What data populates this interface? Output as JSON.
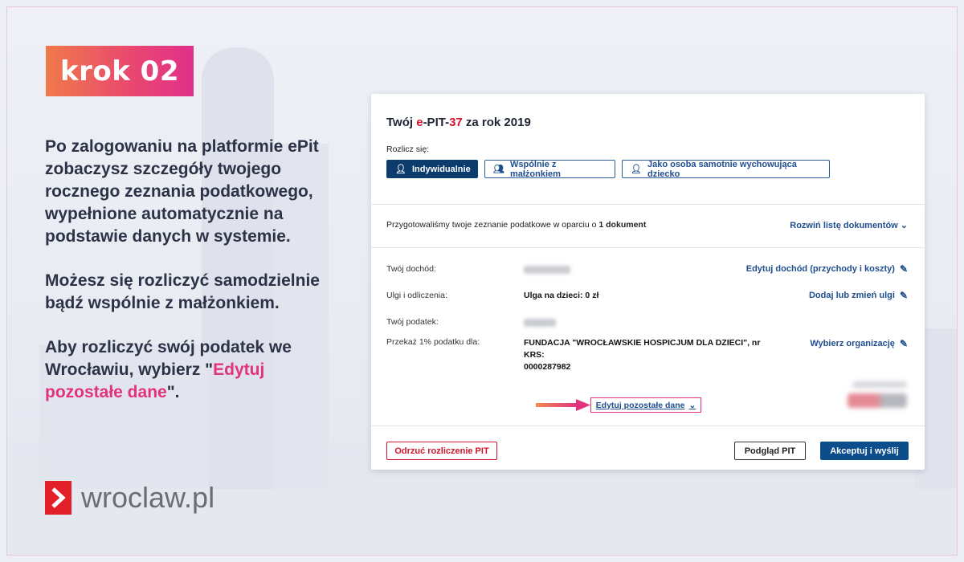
{
  "step_badge": {
    "label": "krok 02"
  },
  "left_text": {
    "paragraph1": "Po zalogowaniu na platformie ePit zobaczysz szczegóły twojego rocznego zeznania podatkowego, wypełnione automatycznie na podstawie danych w systemie.",
    "paragraph2": "Możesz się rozliczyć samodzielnie bądź wspólnie z małżonkiem.",
    "paragraph3_prefix": "Aby rozliczyć swój podatek we Wrocławiu, wybierz \"",
    "paragraph3_highlight": "Edytuj pozostałe dane",
    "paragraph3_suffix": "\"."
  },
  "logo": {
    "text": "wroclaw.pl"
  },
  "card": {
    "title_prefix": "Twój ",
    "title_e": "e",
    "title_pit": "-PIT-",
    "title_number": "37",
    "title_suffix": " za rok 2019",
    "rozlicz_label": "Rozlicz się:",
    "options": [
      {
        "label": "Indywidualnie",
        "icon": "person-icon",
        "active": true
      },
      {
        "label": "Wspólnie z małżonkiem",
        "icon": "couple-icon",
        "active": false
      },
      {
        "label": "Jako osoba samotnie wychowująca dziecko",
        "icon": "parent-child-icon",
        "active": false
      }
    ],
    "prepared_prefix": "Przygotowaliśmy twoje zeznanie podatkowe w oparciu o ",
    "prepared_bold": "1 dokument",
    "expand_label": "Rozwiń listę dokumentów",
    "rows": {
      "income_label": "Twój dochód:",
      "income_action": "Edytuj dochód (przychody i koszty)",
      "relief_label": "Ulgi i odliczenia:",
      "relief_value": "Ulga na dzieci: 0 zł",
      "relief_action": "Dodaj lub zmień ulgi",
      "tax_label": "Twój podatek:",
      "onepercent_label": "Przekaż 1% podatku dla:",
      "onepercent_value_line1": "FUNDACJA \"WROCŁAWSKIE HOSPICJUM DLA DZIECI\", nr KRS:",
      "onepercent_value_line2": "0000287982",
      "onepercent_action": "Wybierz organizację"
    },
    "edit_other_label": "Edytuj pozostałe dane",
    "buttons": {
      "reject": "Odrzuć rozliczenie PIT",
      "preview": "Podgląd PIT",
      "accept": "Akceptuj i wyślij"
    }
  },
  "colors": {
    "accent_pink": "#e3327d",
    "brand_red": "#d0142c",
    "primary_blue": "#0c4d8c",
    "link_blue": "#1f4e8f"
  }
}
